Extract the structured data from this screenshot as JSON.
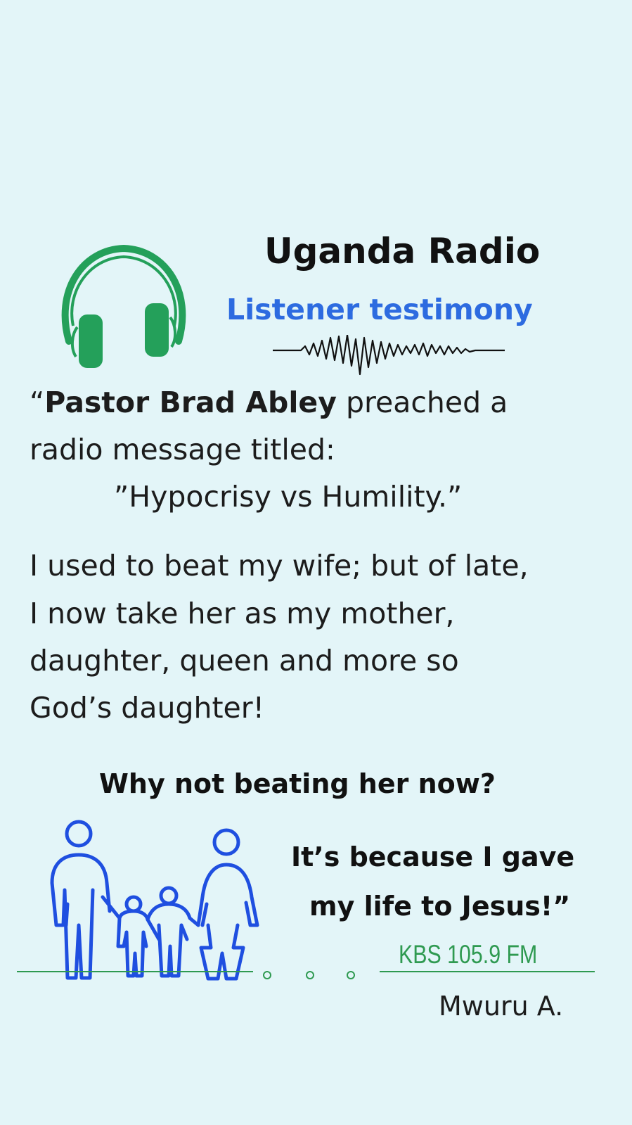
{
  "header": {
    "title": "Uganda Radio",
    "subtitle": "Listener testimony"
  },
  "testimony": {
    "open_quote": "“",
    "pastor_name": "Pastor Brad Abley",
    "line1_rest": " preached a",
    "line2": "radio message titled:",
    "sermon_title": "”Hypocrisy vs Humility.”",
    "para2_line1": " I used to beat my wife; but of late,",
    "para2_line2": "I now take her as my mother,",
    "para2_line3": "daughter, queen and more so",
    "para2_line4": "God’s daughter!",
    "question": "Why not beating her now?",
    "answer_line1": "It’s because I gave",
    "answer_line2": "my life to Jesus!”"
  },
  "footer": {
    "station": "KBS 105.9 FM",
    "signature": "Mwuru A."
  },
  "colors": {
    "background": "#e3f5f8",
    "headphones": "#24a05a",
    "accent_blue": "#2d6be0",
    "family_blue": "#1f4fe0",
    "line_green": "#2f9a51"
  },
  "icons": [
    "headphones-icon",
    "sound-wave-icon",
    "family-icon"
  ]
}
